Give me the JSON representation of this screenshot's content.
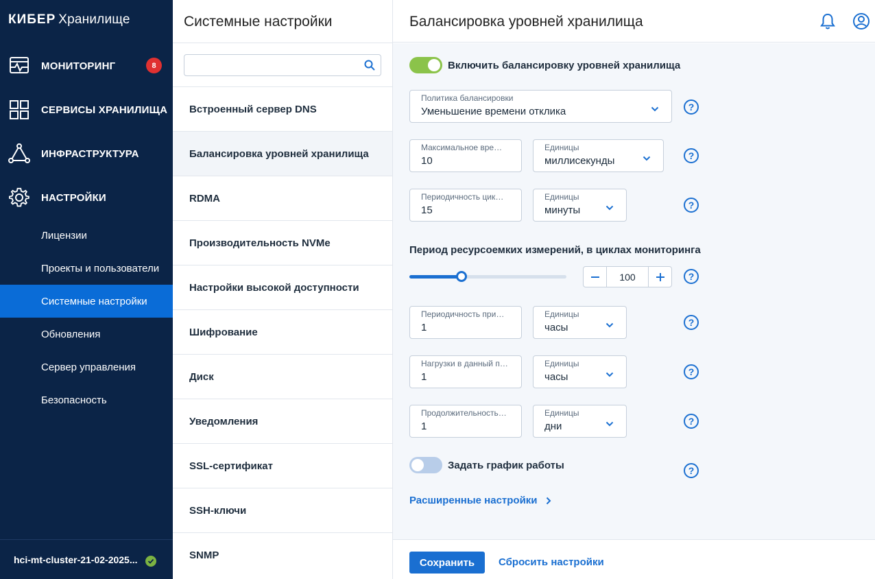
{
  "sidebar": {
    "logo_brand": "КИБЕР",
    "logo_sub": "Хранилище",
    "main_items": [
      {
        "label": "МОНИТОРИНГ",
        "icon": "monitoring-icon",
        "badge": "8"
      },
      {
        "label": "СЕРВИСЫ ХРАНИЛИЩА",
        "icon": "grid-icon"
      },
      {
        "label": "ИНФРАСТРУКТУРА",
        "icon": "network-icon"
      },
      {
        "label": "НАСТРОЙКИ",
        "icon": "gear-icon"
      }
    ],
    "sub_items": [
      "Лицензии",
      "Проекты и пользователи",
      "Системные настройки",
      "Обновления",
      "Сервер управления",
      "Безопасность"
    ],
    "active_sub": "Системные настройки",
    "cluster_name": "hci-mt-cluster-21-02-2025..."
  },
  "middle": {
    "title": "Системные настройки",
    "search_placeholder": "",
    "items": [
      "Встроенный сервер DNS",
      "Балансировка уровней хранилища",
      "RDMA",
      "Производительность NVMe",
      "Настройки высокой доступности",
      "Шифрование",
      "Диск",
      "Уведомления",
      "SSL-сертификат",
      "SSH-ключи",
      "SNMP"
    ],
    "active_item": "Балансировка уровней хранилища"
  },
  "header": {
    "title": "Балансировка уровней хранилища"
  },
  "form": {
    "enable_toggle_label": "Включить балансировку уровней хранилища",
    "enable_toggle_on": true,
    "policy": {
      "label": "Политика балансировки",
      "value": "Уменьшение времени отклика"
    },
    "max_time": {
      "label": "Максимальное время отклика",
      "value": "10"
    },
    "max_time_units": {
      "label": "Единицы",
      "value": "миллисекунды"
    },
    "cycle_period": {
      "label": "Периодичность цикла мониторинга",
      "value": "15"
    },
    "cycle_period_units": {
      "label": "Единицы",
      "value": "минуты"
    },
    "slider_label": "Период ресурсоемких измерений, в циклах мониторинга",
    "slider_fraction": 0.33,
    "stepper_value": "100",
    "apply_period": {
      "label": "Периодичность применения",
      "value": "1"
    },
    "apply_period_units": {
      "label": "Единицы",
      "value": "часы"
    },
    "load_period": {
      "label": "Нагрузки в данный период",
      "value": "1"
    },
    "load_period_units": {
      "label": "Единицы",
      "value": "часы"
    },
    "duration": {
      "label": "Продолжительность хранения",
      "value": "1"
    },
    "duration_units": {
      "label": "Единицы",
      "value": "дни"
    },
    "schedule_toggle_label": "Задать график работы",
    "schedule_toggle_on": false,
    "advanced_link": "Расширенные настройки",
    "help_symbol": "?"
  },
  "footer": {
    "save": "Сохранить",
    "reset": "Сбросить настройки"
  },
  "colors": {
    "sidebar_bg": "#0b2447",
    "accent": "#1a6fd1",
    "active_nav": "#0a6cd7",
    "toggle_on": "#8bc34a",
    "badge": "#e03131"
  }
}
